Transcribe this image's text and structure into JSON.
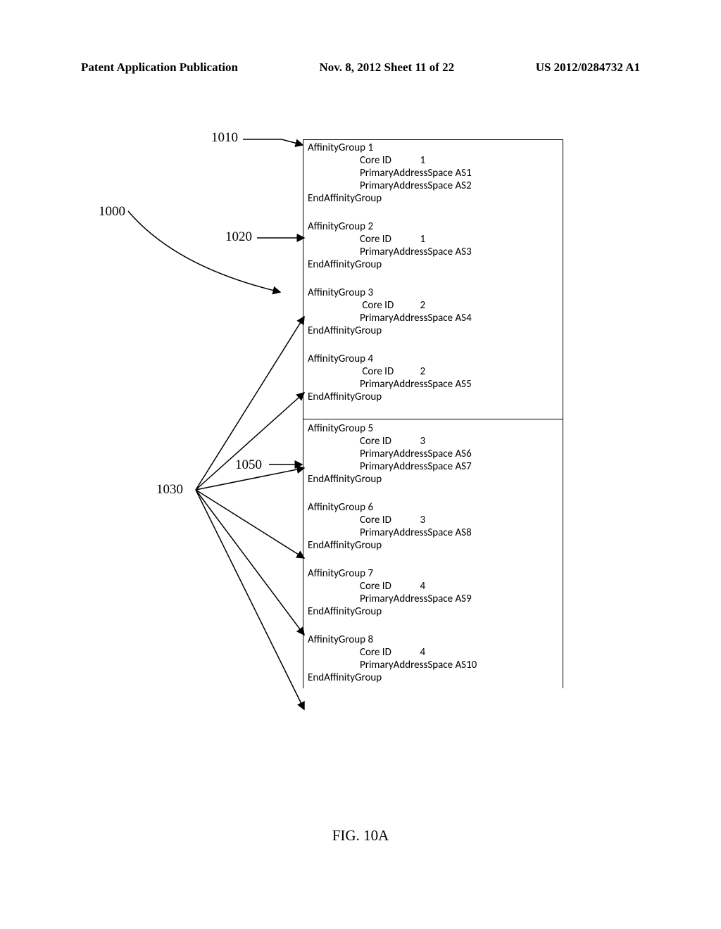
{
  "header": {
    "left": "Patent Application Publication",
    "center": "Nov. 8, 2012  Sheet 11 of 22",
    "right": "US 2012/0284732 A1"
  },
  "refs": {
    "r1000": "1000",
    "r1010": "1010",
    "r1020": "1020",
    "r1030": "1030",
    "r1050": "1050"
  },
  "groups": [
    {
      "title": "AffinityGroup 1",
      "lines": [
        "Core ID            1",
        "PrimaryAddressSpace AS1",
        "PrimaryAddressSpace AS2"
      ],
      "end": "EndAffinityGroup"
    },
    {
      "title": "AffinityGroup 2",
      "lines": [
        "Core ID            1",
        "PrimaryAddressSpace AS3"
      ],
      "end": "EndAffinityGroup"
    },
    {
      "title": "AffinityGroup 3",
      "lines": [
        " Core ID           2",
        "PrimaryAddressSpace AS4"
      ],
      "end": "EndAffinityGroup"
    },
    {
      "title": "AffinityGroup 4",
      "lines": [
        " Core ID           2",
        "PrimaryAddressSpace AS5"
      ],
      "end": "EndAffinityGroup"
    },
    {
      "title": "AffinityGroup 5",
      "lines": [
        "Core ID            3",
        "PrimaryAddressSpace AS6",
        "PrimaryAddressSpace AS7"
      ],
      "end": "EndAffinityGroup",
      "dividerBefore": true
    },
    {
      "title": "AffinityGroup 6",
      "lines": [
        "Core ID            3",
        "PrimaryAddressSpace AS8"
      ],
      "end": "EndAffinityGroup"
    },
    {
      "title": "AffinityGroup 7",
      "lines": [
        "Core ID            4",
        "PrimaryAddressSpace AS9"
      ],
      "end": "EndAffinityGroup"
    },
    {
      "title": "AffinityGroup 8",
      "lines": [
        "Core ID            4",
        "PrimaryAddressSpace AS10"
      ],
      "end": "EndAffinityGroup"
    }
  ],
  "caption": "FIG. 10A"
}
